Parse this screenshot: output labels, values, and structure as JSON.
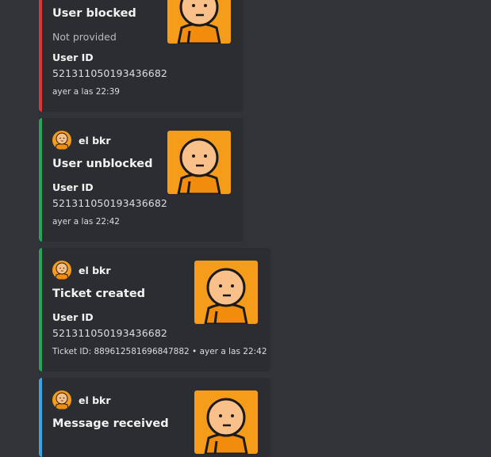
{
  "embeds": [
    {
      "title": "User blocked",
      "description": "Not provided",
      "field_name": "User ID",
      "field_value": "521311050193436682",
      "footer": "ayer a las 22:39",
      "accent": "#da373c"
    },
    {
      "author": "el bkr",
      "title": "User unblocked",
      "field_name": "User ID",
      "field_value": "521311050193436682",
      "footer": "ayer a las 22:42",
      "accent": "#23a55a"
    },
    {
      "author": "el bkr",
      "title": "Ticket created",
      "field_name": "User ID",
      "field_value": "521311050193436682",
      "footer": "Ticket ID: 889612581696847882 • ayer a las 22:42",
      "accent": "#23a55a"
    },
    {
      "author": "el bkr",
      "title": "Message received",
      "accent": "#3ba5e0"
    }
  ],
  "colors": {
    "background": "#313338",
    "embed_background": "#2b2d31",
    "avatar_orange": "#f59c1a",
    "avatar_skin": "#f9c089"
  },
  "icons": {
    "avatar": "cartoon-face-avatar-icon"
  }
}
